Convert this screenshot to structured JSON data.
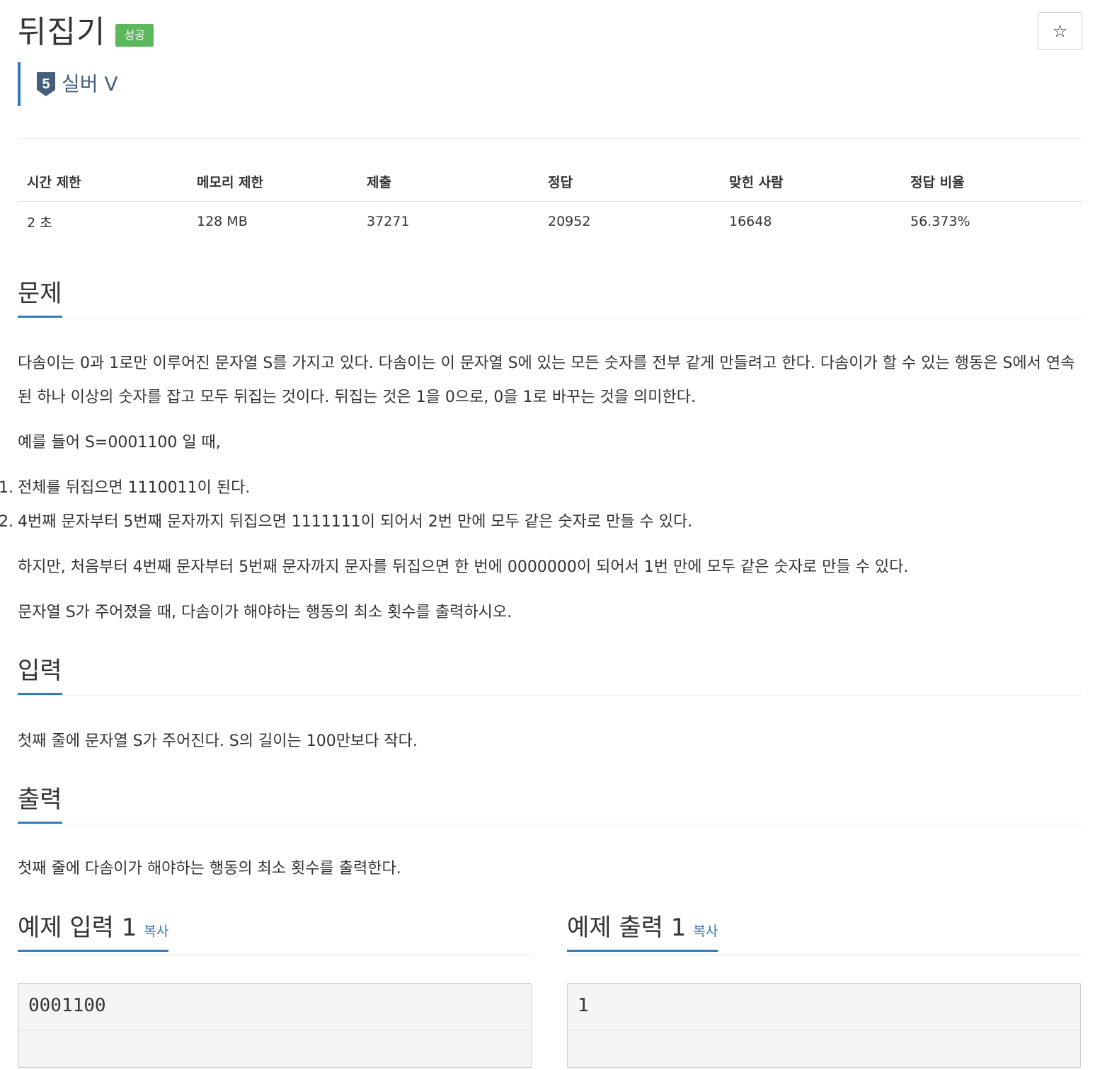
{
  "problem": {
    "title": "뒤집기",
    "result_badge": "성공",
    "tier": "실버 V",
    "tier_level": "5",
    "star_icon": "☆"
  },
  "info_table": {
    "headers": [
      "시간 제한",
      "메모리 제한",
      "제출",
      "정답",
      "맞힌 사람",
      "정답 비율"
    ],
    "values": [
      "2 초",
      "128 MB",
      "37271",
      "20952",
      "16648",
      "56.373%"
    ]
  },
  "sections": {
    "description_title": "문제",
    "input_title": "입력",
    "output_title": "출력"
  },
  "description": {
    "p1": "다솜이는 0과 1로만 이루어진 문자열 S를 가지고 있다. 다솜이는 이 문자열 S에 있는 모든 숫자를 전부 같게 만들려고 한다. 다솜이가 할 수 있는 행동은 S에서 연속된 하나 이상의 숫자를 잡고 모두 뒤집는 것이다. 뒤집는 것은 1을 0으로, 0을 1로 바꾸는 것을 의미한다.",
    "p2": "예를 들어 S=0001100 일 때,",
    "list": [
      {
        "num": "1.",
        "text": "전체를 뒤집으면 1110011이 된다."
      },
      {
        "num": "2.",
        "text": "4번째 문자부터 5번째 문자까지 뒤집으면 1111111이 되어서 2번 만에 모두 같은 숫자로 만들 수 있다."
      }
    ],
    "p3": "하지만, 처음부터 4번째 문자부터 5번째 문자까지 문자를 뒤집으면 한 번에 0000000이 되어서 1번 만에 모두 같은 숫자로 만들 수 있다.",
    "p4": "문자열 S가 주어졌을 때, 다솜이가 해야하는 행동의 최소 횟수를 출력하시오."
  },
  "input_text": "첫째 줄에 문자열 S가 주어진다. S의 길이는 100만보다 작다.",
  "output_text": "첫째 줄에 다솜이가 해야하는 행동의 최소 횟수를 출력한다.",
  "examples": {
    "input_title": "예제 입력 1",
    "output_title": "예제 출력 1",
    "copy_label": "복사",
    "sample_input": "0001100",
    "sample_output": "1"
  },
  "colors": {
    "accent": "#337ab7",
    "success": "#5cb85c",
    "tier_silver": "#435f7a"
  }
}
